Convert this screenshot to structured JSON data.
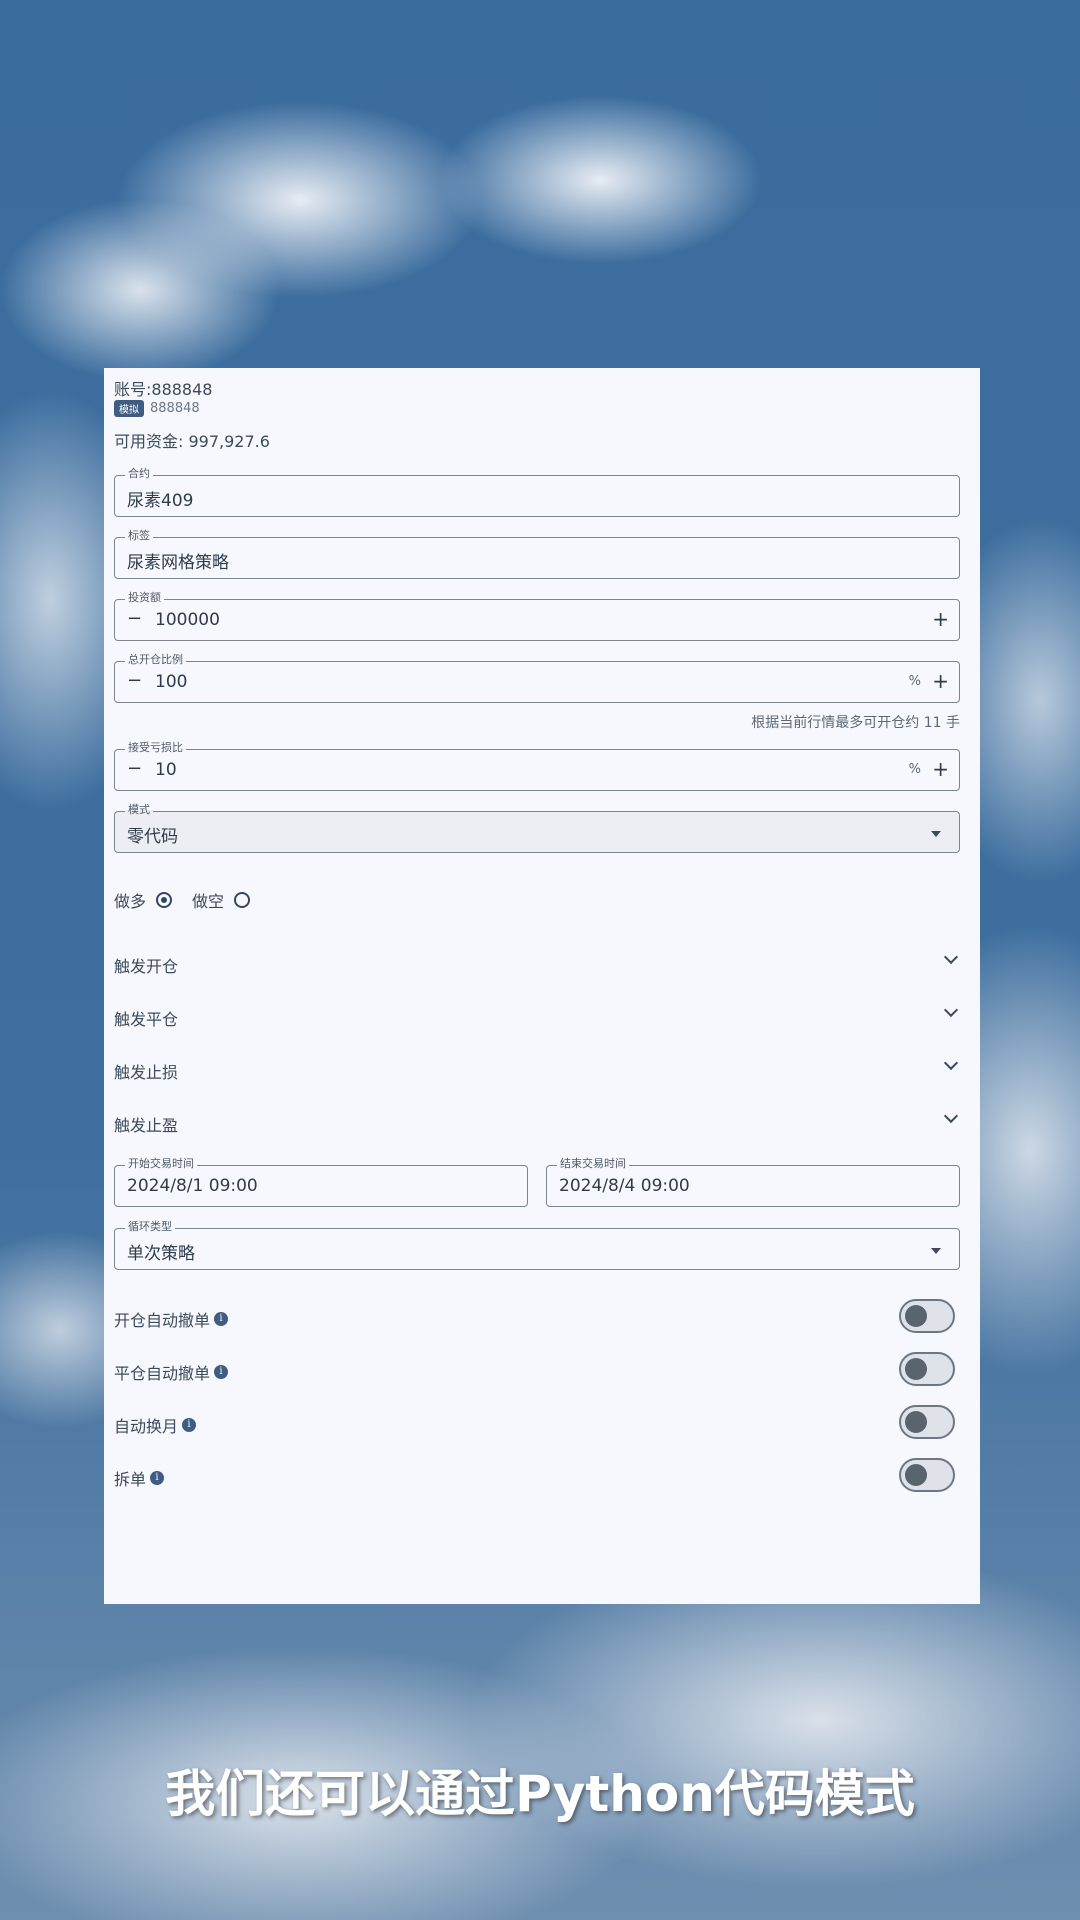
{
  "account": {
    "label": "账号:888848",
    "badge": "模拟",
    "id": "888848",
    "funds": "可用资金: 997,927.6"
  },
  "form": {
    "contract": {
      "label": "合约",
      "value": "尿素409"
    },
    "tag": {
      "label": "标签",
      "value": "尿素网格策略"
    },
    "investment": {
      "label": "投资额",
      "value": "100000",
      "minus": "−",
      "plus": "+"
    },
    "open_ratio": {
      "label": "总开仓比例",
      "value": "100",
      "unit": "%",
      "minus": "−",
      "plus": "+"
    },
    "hint": "根据当前行情最多可开仓约 11 手",
    "loss_ratio": {
      "label": "接受亏损比",
      "value": "10",
      "unit": "%",
      "minus": "−",
      "plus": "+"
    },
    "mode": {
      "label": "模式",
      "value": "零代码"
    },
    "direction": {
      "long": {
        "label": "做多",
        "selected": true
      },
      "short": {
        "label": "做空",
        "selected": false
      }
    },
    "sections": [
      "触发开仓",
      "触发平仓",
      "触发止损",
      "触发止盈"
    ],
    "start_time": {
      "label": "开始交易时间",
      "value": "2024/8/1 09:00"
    },
    "end_time": {
      "label": "结束交易时间",
      "value": "2024/8/4 09:00"
    },
    "cycle_type": {
      "label": "循环类型",
      "value": "单次策略"
    },
    "toggles": [
      {
        "label": "开仓自动撤单",
        "on": false
      },
      {
        "label": "平仓自动撤单",
        "on": false
      },
      {
        "label": "自动换月",
        "on": false
      },
      {
        "label": "拆单",
        "on": false
      }
    ],
    "info_icon": "i"
  },
  "subtitle": "我们还可以通过Python代码模式"
}
